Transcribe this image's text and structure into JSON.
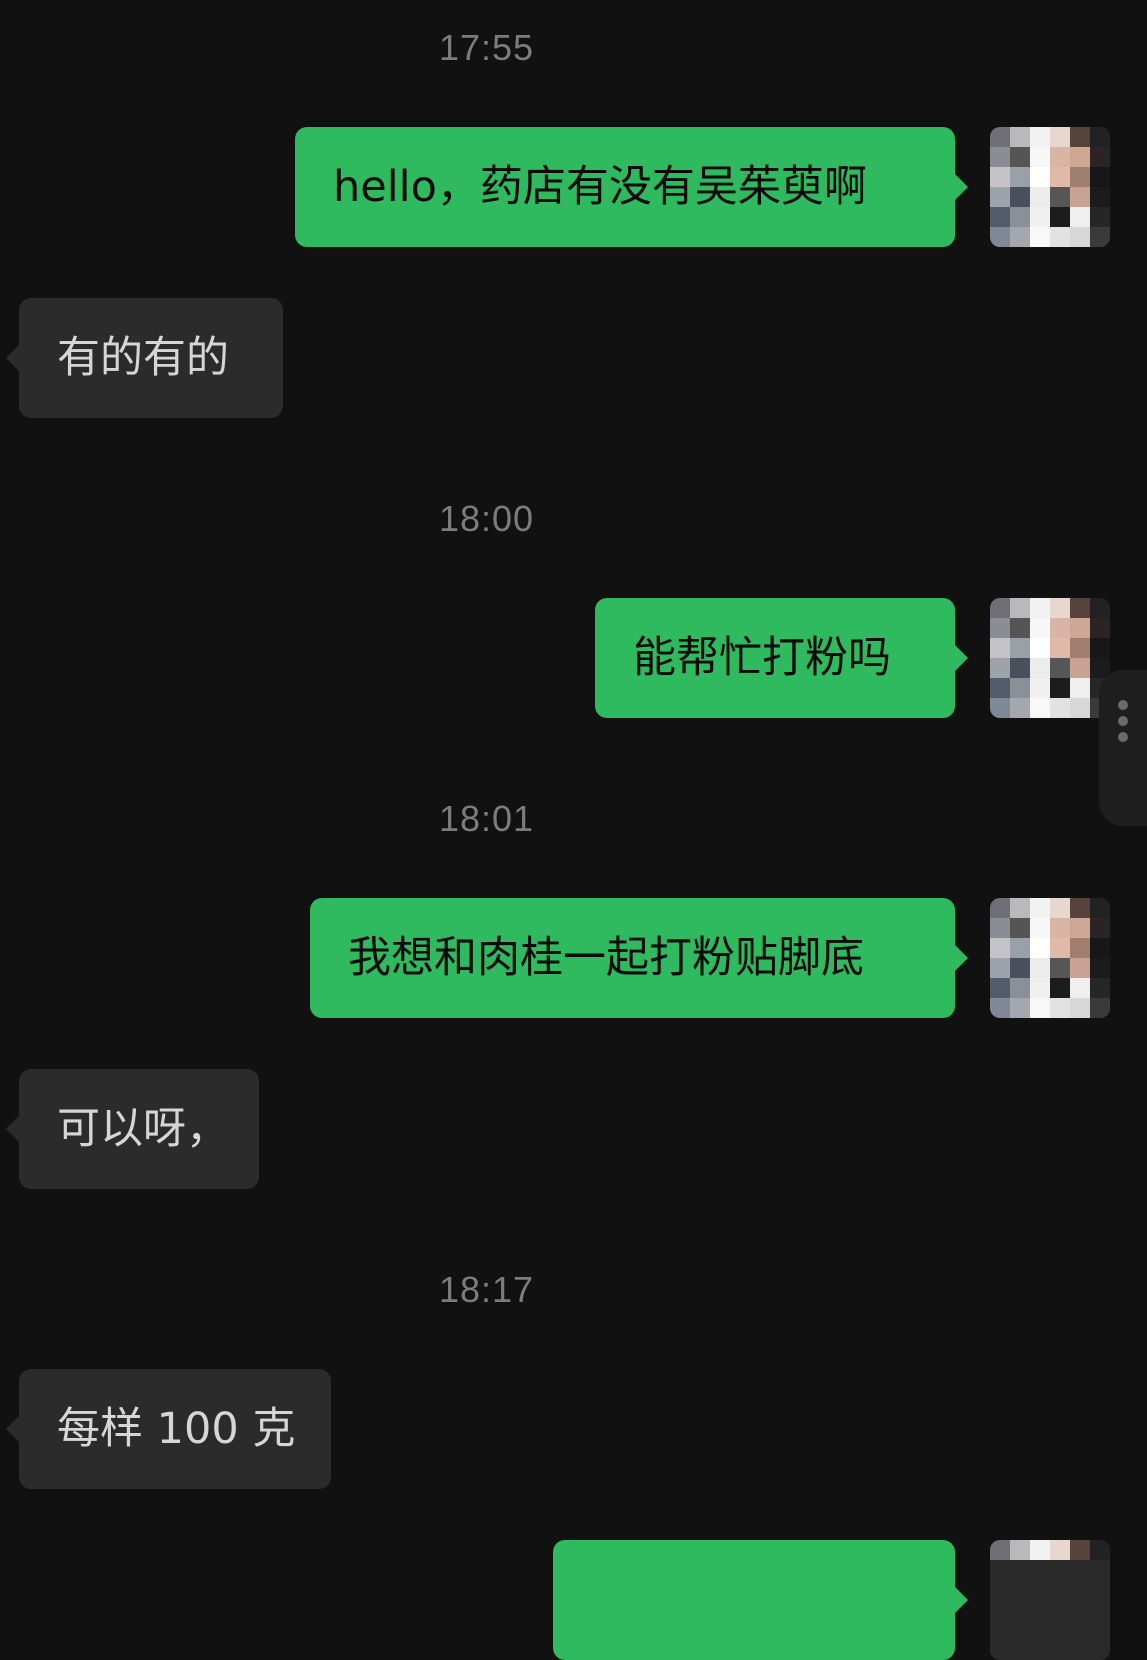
{
  "colors": {
    "background": "#111111",
    "my_bubble": "#2fba5f",
    "their_bubble": "#2b2b2b",
    "timestamp": "#7c7c7c"
  },
  "messages": [
    {
      "kind": "timestamp",
      "text": "17:55"
    },
    {
      "kind": "sent",
      "text": "hello，药店有没有吴茱萸啊",
      "avatar_icon": "pixelated-avatar-icon"
    },
    {
      "kind": "received",
      "text": "有的有的"
    },
    {
      "kind": "timestamp",
      "text": "18:00"
    },
    {
      "kind": "sent",
      "text": "能帮忙打粉吗",
      "avatar_icon": "pixelated-avatar-icon"
    },
    {
      "kind": "timestamp",
      "text": "18:01"
    },
    {
      "kind": "sent",
      "text": "我想和肉桂一起打粉贴脚底",
      "avatar_icon": "pixelated-avatar-icon"
    },
    {
      "kind": "received",
      "text": "可以呀，"
    },
    {
      "kind": "timestamp",
      "text": "18:17"
    },
    {
      "kind": "received",
      "text": "每样 100 克"
    },
    {
      "kind": "sent",
      "text": "",
      "avatar_icon": "pixelated-avatar-icon"
    }
  ],
  "side_handle": {
    "icon": "more-vertical-icon"
  }
}
